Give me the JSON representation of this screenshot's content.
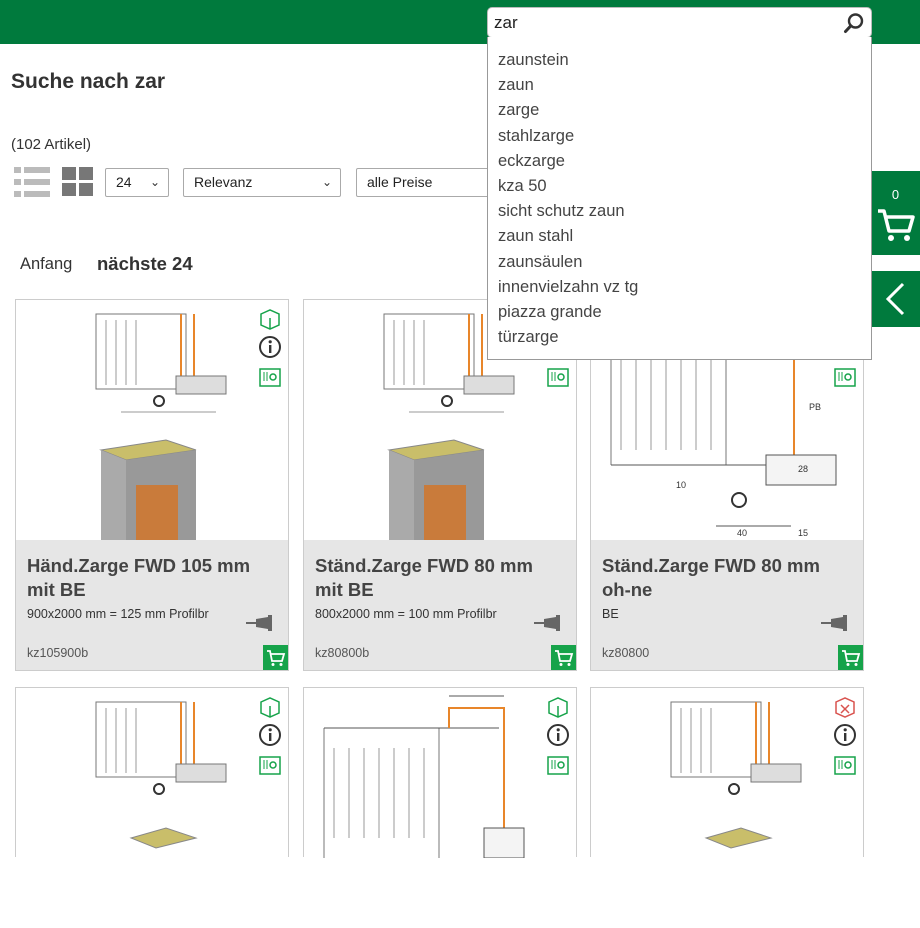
{
  "search": {
    "value": "zar",
    "suggestions": [
      "zaunstein",
      "zaun",
      "zarge",
      "stahlzarge",
      "eckzarge",
      "kza 50",
      "sicht schutz zaun",
      "zaun stahl",
      "zaunsäulen",
      "innenvielzahn vz tg",
      "piazza grande",
      "türzarge"
    ]
  },
  "heading": "Suche nach zar",
  "result_count": "(102 Artikel)",
  "toolbar": {
    "per_page": "24",
    "sort": "Relevanz",
    "price": "alle Preise"
  },
  "pager": {
    "start": "Anfang",
    "next": "nächste 24"
  },
  "cart": {
    "count": "0"
  },
  "products": [
    {
      "name": "Händ.Zarge FWD 105 mm mit BE",
      "desc": "900x2000 mm = 125 mm Profilbr",
      "sku": "kz105900b"
    },
    {
      "name": "Ständ.Zarge FWD 80 mm mit BE",
      "desc": "800x2000 mm = 100 mm Profilbr",
      "sku": "kz80800b"
    },
    {
      "name": "Ständ.Zarge FWD 80 mm oh-ne",
      "desc": "BE",
      "sku": "kz80800"
    }
  ],
  "drawing_labels": {
    "dim_40": "40",
    "dim_10": "10",
    "dim_pb": "PB",
    "dim_28": "28",
    "dim_15": "15"
  },
  "colors": {
    "brand_green": "#007a3d",
    "buy_green": "#16a34a",
    "orange": "#e8862a",
    "not_available_red": "#d9534f"
  }
}
